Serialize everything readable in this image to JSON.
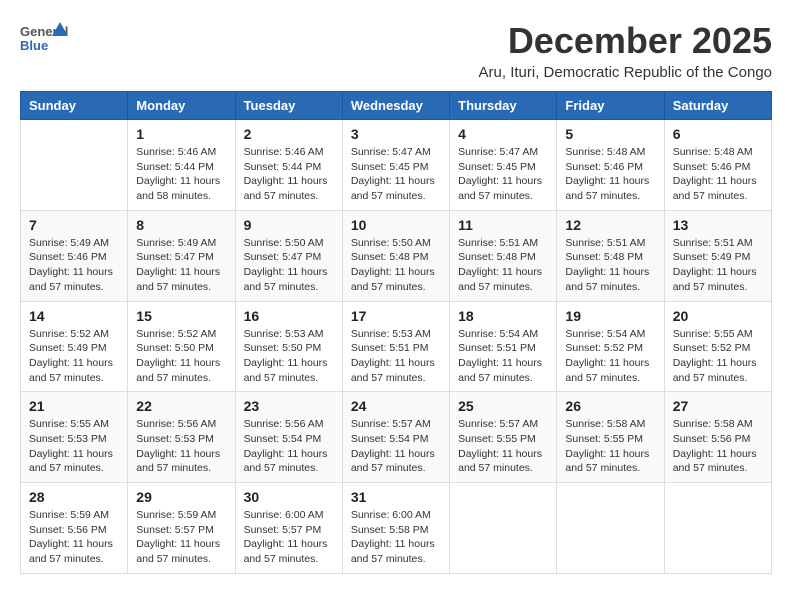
{
  "logo": {
    "general": "General",
    "blue": "Blue"
  },
  "title": "December 2025",
  "subtitle": "Aru, Ituri, Democratic Republic of the Congo",
  "weekdays": [
    "Sunday",
    "Monday",
    "Tuesday",
    "Wednesday",
    "Thursday",
    "Friday",
    "Saturday"
  ],
  "weeks": [
    [
      {
        "day": "",
        "sunrise": "",
        "sunset": "",
        "daylight": ""
      },
      {
        "day": "1",
        "sunrise": "Sunrise: 5:46 AM",
        "sunset": "Sunset: 5:44 PM",
        "daylight": "Daylight: 11 hours and 58 minutes."
      },
      {
        "day": "2",
        "sunrise": "Sunrise: 5:46 AM",
        "sunset": "Sunset: 5:44 PM",
        "daylight": "Daylight: 11 hours and 57 minutes."
      },
      {
        "day": "3",
        "sunrise": "Sunrise: 5:47 AM",
        "sunset": "Sunset: 5:45 PM",
        "daylight": "Daylight: 11 hours and 57 minutes."
      },
      {
        "day": "4",
        "sunrise": "Sunrise: 5:47 AM",
        "sunset": "Sunset: 5:45 PM",
        "daylight": "Daylight: 11 hours and 57 minutes."
      },
      {
        "day": "5",
        "sunrise": "Sunrise: 5:48 AM",
        "sunset": "Sunset: 5:46 PM",
        "daylight": "Daylight: 11 hours and 57 minutes."
      },
      {
        "day": "6",
        "sunrise": "Sunrise: 5:48 AM",
        "sunset": "Sunset: 5:46 PM",
        "daylight": "Daylight: 11 hours and 57 minutes."
      }
    ],
    [
      {
        "day": "7",
        "sunrise": "Sunrise: 5:49 AM",
        "sunset": "Sunset: 5:46 PM",
        "daylight": "Daylight: 11 hours and 57 minutes."
      },
      {
        "day": "8",
        "sunrise": "Sunrise: 5:49 AM",
        "sunset": "Sunset: 5:47 PM",
        "daylight": "Daylight: 11 hours and 57 minutes."
      },
      {
        "day": "9",
        "sunrise": "Sunrise: 5:50 AM",
        "sunset": "Sunset: 5:47 PM",
        "daylight": "Daylight: 11 hours and 57 minutes."
      },
      {
        "day": "10",
        "sunrise": "Sunrise: 5:50 AM",
        "sunset": "Sunset: 5:48 PM",
        "daylight": "Daylight: 11 hours and 57 minutes."
      },
      {
        "day": "11",
        "sunrise": "Sunrise: 5:51 AM",
        "sunset": "Sunset: 5:48 PM",
        "daylight": "Daylight: 11 hours and 57 minutes."
      },
      {
        "day": "12",
        "sunrise": "Sunrise: 5:51 AM",
        "sunset": "Sunset: 5:48 PM",
        "daylight": "Daylight: 11 hours and 57 minutes."
      },
      {
        "day": "13",
        "sunrise": "Sunrise: 5:51 AM",
        "sunset": "Sunset: 5:49 PM",
        "daylight": "Daylight: 11 hours and 57 minutes."
      }
    ],
    [
      {
        "day": "14",
        "sunrise": "Sunrise: 5:52 AM",
        "sunset": "Sunset: 5:49 PM",
        "daylight": "Daylight: 11 hours and 57 minutes."
      },
      {
        "day": "15",
        "sunrise": "Sunrise: 5:52 AM",
        "sunset": "Sunset: 5:50 PM",
        "daylight": "Daylight: 11 hours and 57 minutes."
      },
      {
        "day": "16",
        "sunrise": "Sunrise: 5:53 AM",
        "sunset": "Sunset: 5:50 PM",
        "daylight": "Daylight: 11 hours and 57 minutes."
      },
      {
        "day": "17",
        "sunrise": "Sunrise: 5:53 AM",
        "sunset": "Sunset: 5:51 PM",
        "daylight": "Daylight: 11 hours and 57 minutes."
      },
      {
        "day": "18",
        "sunrise": "Sunrise: 5:54 AM",
        "sunset": "Sunset: 5:51 PM",
        "daylight": "Daylight: 11 hours and 57 minutes."
      },
      {
        "day": "19",
        "sunrise": "Sunrise: 5:54 AM",
        "sunset": "Sunset: 5:52 PM",
        "daylight": "Daylight: 11 hours and 57 minutes."
      },
      {
        "day": "20",
        "sunrise": "Sunrise: 5:55 AM",
        "sunset": "Sunset: 5:52 PM",
        "daylight": "Daylight: 11 hours and 57 minutes."
      }
    ],
    [
      {
        "day": "21",
        "sunrise": "Sunrise: 5:55 AM",
        "sunset": "Sunset: 5:53 PM",
        "daylight": "Daylight: 11 hours and 57 minutes."
      },
      {
        "day": "22",
        "sunrise": "Sunrise: 5:56 AM",
        "sunset": "Sunset: 5:53 PM",
        "daylight": "Daylight: 11 hours and 57 minutes."
      },
      {
        "day": "23",
        "sunrise": "Sunrise: 5:56 AM",
        "sunset": "Sunset: 5:54 PM",
        "daylight": "Daylight: 11 hours and 57 minutes."
      },
      {
        "day": "24",
        "sunrise": "Sunrise: 5:57 AM",
        "sunset": "Sunset: 5:54 PM",
        "daylight": "Daylight: 11 hours and 57 minutes."
      },
      {
        "day": "25",
        "sunrise": "Sunrise: 5:57 AM",
        "sunset": "Sunset: 5:55 PM",
        "daylight": "Daylight: 11 hours and 57 minutes."
      },
      {
        "day": "26",
        "sunrise": "Sunrise: 5:58 AM",
        "sunset": "Sunset: 5:55 PM",
        "daylight": "Daylight: 11 hours and 57 minutes."
      },
      {
        "day": "27",
        "sunrise": "Sunrise: 5:58 AM",
        "sunset": "Sunset: 5:56 PM",
        "daylight": "Daylight: 11 hours and 57 minutes."
      }
    ],
    [
      {
        "day": "28",
        "sunrise": "Sunrise: 5:59 AM",
        "sunset": "Sunset: 5:56 PM",
        "daylight": "Daylight: 11 hours and 57 minutes."
      },
      {
        "day": "29",
        "sunrise": "Sunrise: 5:59 AM",
        "sunset": "Sunset: 5:57 PM",
        "daylight": "Daylight: 11 hours and 57 minutes."
      },
      {
        "day": "30",
        "sunrise": "Sunrise: 6:00 AM",
        "sunset": "Sunset: 5:57 PM",
        "daylight": "Daylight: 11 hours and 57 minutes."
      },
      {
        "day": "31",
        "sunrise": "Sunrise: 6:00 AM",
        "sunset": "Sunset: 5:58 PM",
        "daylight": "Daylight: 11 hours and 57 minutes."
      },
      {
        "day": "",
        "sunrise": "",
        "sunset": "",
        "daylight": ""
      },
      {
        "day": "",
        "sunrise": "",
        "sunset": "",
        "daylight": ""
      },
      {
        "day": "",
        "sunrise": "",
        "sunset": "",
        "daylight": ""
      }
    ]
  ]
}
